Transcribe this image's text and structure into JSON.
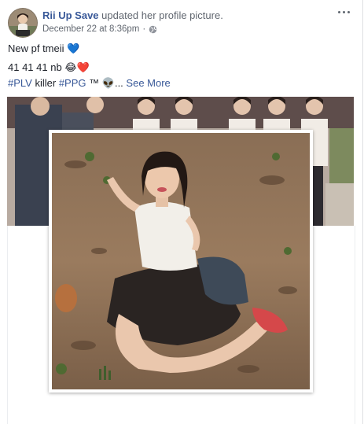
{
  "post": {
    "author": "Rii Up Save",
    "action": "updated her profile picture.",
    "timestamp": "December 22 at 8:36pm",
    "separator": "·",
    "privacy_icon": "globe-icon",
    "options_icon": "more-options-icon",
    "lines": {
      "line1_text": "New pf tmeii",
      "line1_emoji": "💙",
      "line2_text": "41 41 41 nb",
      "line2_emoji": "😂❤️",
      "hashtag1": "#PLV",
      "between": "killer",
      "hashtag2": "#PPG",
      "tm": "™",
      "skull": "👽",
      "ellipsis": "...",
      "see_more": "See More"
    }
  },
  "colors": {
    "link": "#385898",
    "text": "#1d2129",
    "meta": "#616770"
  }
}
